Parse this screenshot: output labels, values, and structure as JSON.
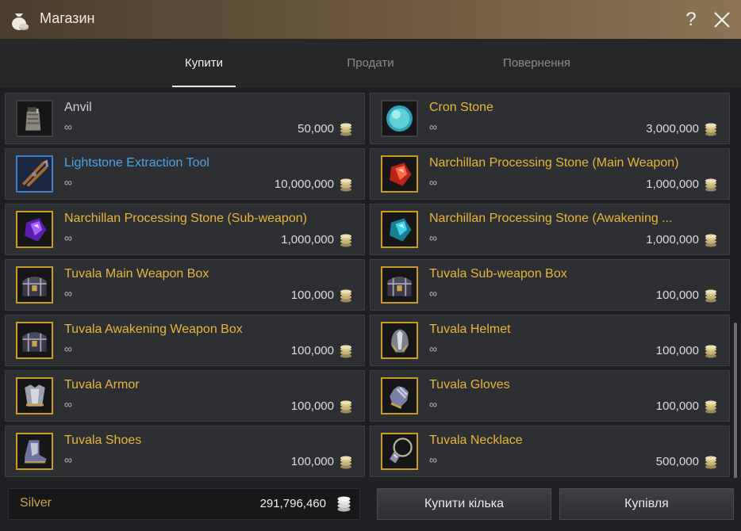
{
  "window": {
    "title": "Магазин"
  },
  "tabs": [
    {
      "label": "Купити"
    },
    {
      "label": "Продати"
    },
    {
      "label": "Повернення"
    }
  ],
  "items": [
    {
      "name": "Anvil",
      "qty": "∞",
      "price": "50,000"
    },
    {
      "name": "Cron Stone",
      "qty": "∞",
      "price": "3,000,000"
    },
    {
      "name": "Lightstone Extraction Tool",
      "qty": "∞",
      "price": "10,000,000"
    },
    {
      "name": "Narchillan Processing Stone (Main Weapon)",
      "qty": "∞",
      "price": "1,000,000"
    },
    {
      "name": "Narchillan Processing Stone (Sub-weapon)",
      "qty": "∞",
      "price": "1,000,000"
    },
    {
      "name": "Narchillan Processing Stone (Awakening ...",
      "qty": "∞",
      "price": "1,000,000"
    },
    {
      "name": "Tuvala Main Weapon Box",
      "qty": "∞",
      "price": "100,000"
    },
    {
      "name": "Tuvala Sub-weapon Box",
      "qty": "∞",
      "price": "100,000"
    },
    {
      "name": "Tuvala Awakening Weapon Box",
      "qty": "∞",
      "price": "100,000"
    },
    {
      "name": "Tuvala Helmet",
      "qty": "∞",
      "price": "100,000"
    },
    {
      "name": "Tuvala Armor",
      "qty": "∞",
      "price": "100,000"
    },
    {
      "name": "Tuvala Gloves",
      "qty": "∞",
      "price": "100,000"
    },
    {
      "name": "Tuvala Shoes",
      "qty": "∞",
      "price": "100,000"
    },
    {
      "name": "Tuvala Necklace",
      "qty": "∞",
      "price": "500,000"
    }
  ],
  "footer": {
    "silver_label": "Silver",
    "silver_value": "291,796,460",
    "buy_some_label": "Купити кілька",
    "buy_label": "Купівля"
  },
  "colors": {
    "item_white": "#cfcfcf",
    "item_blue": "#4aa2e6",
    "item_gold": "#e8b43a",
    "silver_label": "#c9a34a"
  }
}
